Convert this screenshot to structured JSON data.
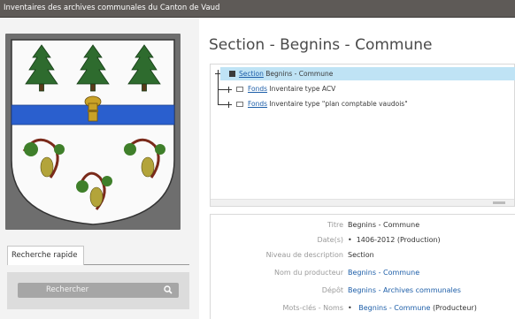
{
  "header": {
    "title": "Inventaires des archives communales du Canton de Vaud"
  },
  "sidebar": {
    "coat_of_arms": "blason-begnins",
    "search_tab": "Recherche rapide",
    "search_button": "Rechercher",
    "search_icon": "search-icon"
  },
  "page": {
    "title": "Section - Begnins - Commune"
  },
  "tree": {
    "root": {
      "type": "Section",
      "label": "Begnins - Commune"
    },
    "children": [
      {
        "type": "Fonds",
        "label": "Inventaire type ACV"
      },
      {
        "type": "Fonds",
        "label": "Inventaire type \"plan comptable vaudois\""
      }
    ]
  },
  "details": [
    {
      "label": "Titre",
      "value": "Begnins - Commune",
      "bullet": false,
      "link": false
    },
    {
      "label": "Date(s)",
      "value": "1406-2012 (Production)",
      "bullet": true,
      "link": false
    },
    {
      "label": "Niveau de description",
      "value": "Section",
      "bullet": false,
      "link": false
    },
    {
      "label": "Nom du producteur",
      "value": "Begnins - Commune",
      "bullet": false,
      "link": true
    },
    {
      "label": "Dépôt",
      "value": "Begnins - Archives communales",
      "bullet": false,
      "link": true
    },
    {
      "label": "Mots-clés - Noms",
      "value": "Begnins - Commune",
      "suffix": "(Producteur)",
      "bullet": true,
      "link": true
    }
  ]
}
